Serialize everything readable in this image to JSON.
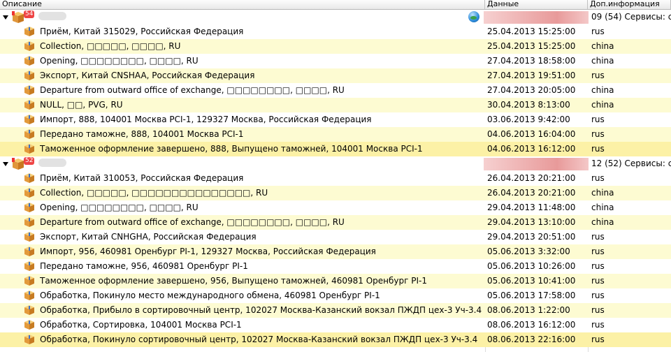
{
  "columns": {
    "desc": "Описание",
    "date": "Данные",
    "info": "Доп.информация"
  },
  "groups": [
    {
      "badge": "54",
      "info": "09 (54) Сервисы: с",
      "items": [
        {
          "desc": "Приём, Китай 315029, Российская Федерация",
          "date": "25.04.2013 15:25:00",
          "info": "rus"
        },
        {
          "desc": "Collection, □□□□□, □□□□, RU",
          "date": "25.04.2013 15:25:00",
          "info": "china"
        },
        {
          "desc": "Opening, □□□□□□□□, □□□□, RU",
          "date": "27.04.2013 18:58:00",
          "info": "china"
        },
        {
          "desc": "Экспорт, Китай CNSHAA, Российская Федерация",
          "date": "27.04.2013 19:51:00",
          "info": "rus"
        },
        {
          "desc": "Departure from outward office of exchange, □□□□□□□□, □□□□, RU",
          "date": "27.04.2013 20:05:00",
          "info": "china"
        },
        {
          "desc": "NULL, □□, PVG, RU",
          "date": "30.04.2013 8:13:00",
          "info": "china"
        },
        {
          "desc": "Импорт, 888, 104001 Москва PCI-1, 129327 Москва, Российская Федерация",
          "date": "03.06.2013 9:42:00",
          "info": "rus"
        },
        {
          "desc": "Передано таможне, 888, 104001 Москва PCI-1",
          "date": "04.06.2013 16:04:00",
          "info": "rus"
        },
        {
          "desc": "Таможенное оформление завершено, 888, Выпущено таможней, 104001 Москва PCI-1",
          "date": "04.06.2013 16:12:00",
          "info": "rus"
        }
      ]
    },
    {
      "badge": "52",
      "info": "12 (52) Сервисы: с",
      "items": [
        {
          "desc": "Приём, Китай 310053, Российская Федерация",
          "date": "26.04.2013 20:21:00",
          "info": "rus"
        },
        {
          "desc": "Collection, □□□□□, □□□□□□□□□□□□□□□, RU",
          "date": "26.04.2013 20:21:00",
          "info": "china"
        },
        {
          "desc": "Opening, □□□□□□□□, □□□□, RU",
          "date": "29.04.2013 11:48:00",
          "info": "china"
        },
        {
          "desc": "Departure from outward office of exchange, □□□□□□□□, □□□□, RU",
          "date": "29.04.2013 13:10:00",
          "info": "china"
        },
        {
          "desc": "Экспорт, Китай CNHGHA, Российская Федерация",
          "date": "29.04.2013 20:51:00",
          "info": "rus"
        },
        {
          "desc": "Импорт, 956, 460981 Оренбург PI-1, 129327 Москва, Российская Федерация",
          "date": "05.06.2013 3:32:00",
          "info": "rus"
        },
        {
          "desc": "Передано таможне, 956, 460981 Оренбург PI-1",
          "date": "05.06.2013 10:26:00",
          "info": "rus"
        },
        {
          "desc": "Таможенное оформление завершено, 956, Выпущено таможней, 460981 Оренбург PI-1",
          "date": "05.06.2013 10:41:00",
          "info": "rus"
        },
        {
          "desc": "Обработка, Покинуло место международного обмена, 460981 Оренбург PI-1",
          "date": "05.06.2013 17:58:00",
          "info": "rus"
        },
        {
          "desc": "Обработка, Прибыло в сортировочный центр, 102027 Москва-Казанский вокзал ПЖДП цех-3 Уч-3.4",
          "date": "08.06.2013 1:22:00",
          "info": "rus"
        },
        {
          "desc": "Обработка, Сортировка, 104001 Москва PCI-1",
          "date": "08.06.2013 16:12:00",
          "info": "rus"
        },
        {
          "desc": "Обработка, Покинуло сортировочный центр, 102027 Москва-Казанский вокзал ПЖДП цех-3 Уч-3.4",
          "date": "08.06.2013 22:16:00",
          "info": "rus"
        }
      ]
    }
  ]
}
